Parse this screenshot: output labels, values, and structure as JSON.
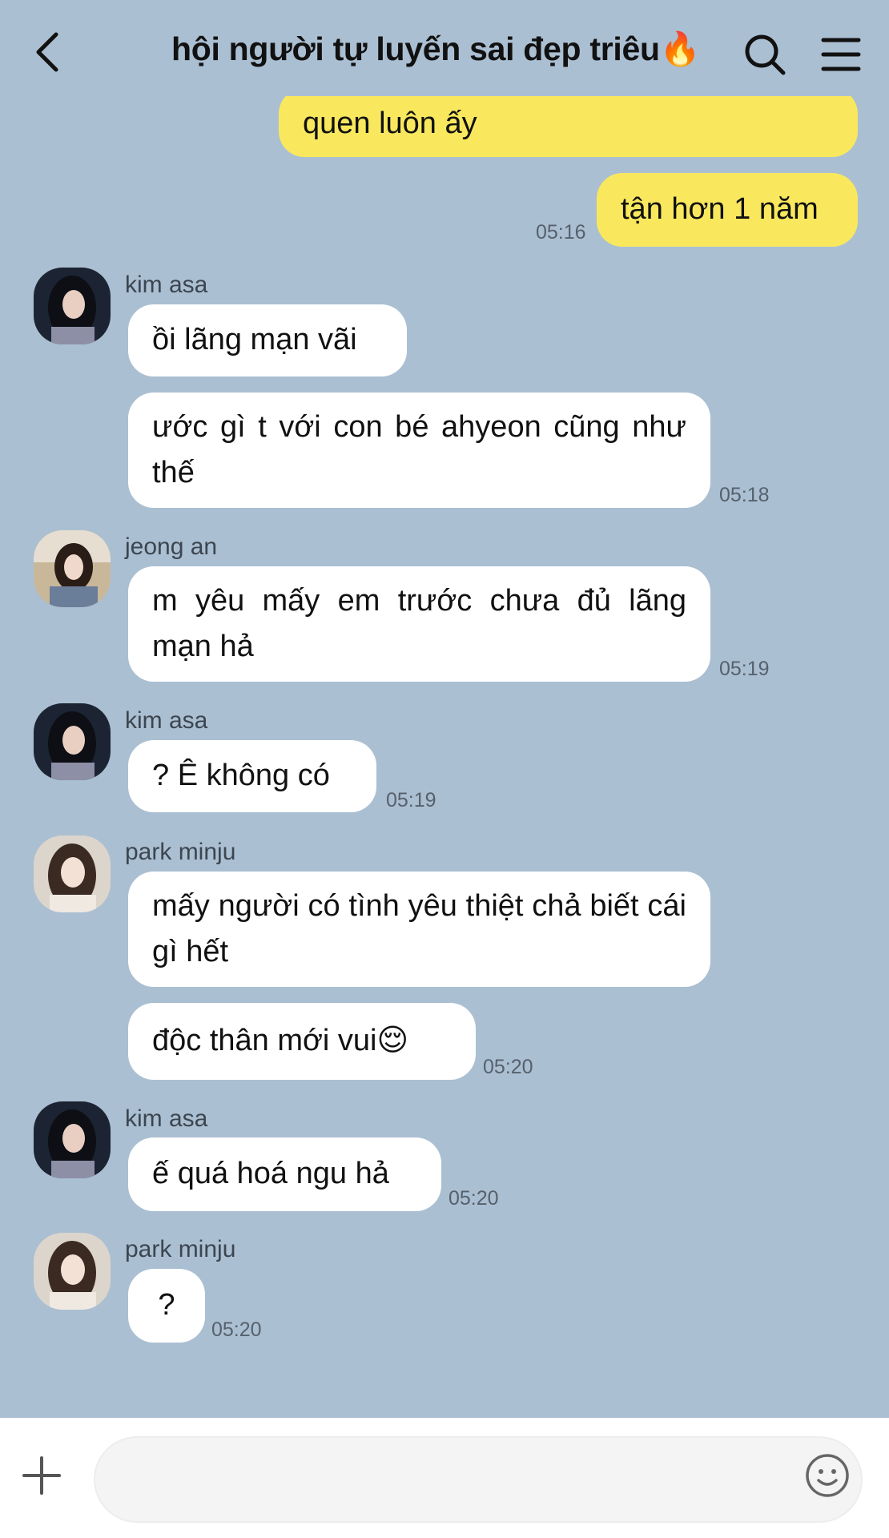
{
  "header": {
    "title": "hội người tự luyến sai đẹp triêu🔥"
  },
  "messages": {
    "m1": {
      "text": "quen luôn ấy"
    },
    "m2": {
      "text": "tận hơn 1 năm",
      "time": "05:16"
    },
    "g1": {
      "sender": "kim asa",
      "b1": "ồi lãng mạn vãi",
      "b2": "ước gì t với con bé ahyeon cũng như thế",
      "time": "05:18"
    },
    "g2": {
      "sender": "jeong an",
      "b1": "m yêu mấy em trước chưa đủ lãng mạn hả",
      "time": "05:19"
    },
    "g3": {
      "sender": "kim asa",
      "b1": "? Ê không có",
      "time": "05:19"
    },
    "g4": {
      "sender": "park minju",
      "b1": "mấy người có tình yêu thiệt chả biết cái gì hết",
      "b2": "độc thân mới vui😌",
      "time": "05:20"
    },
    "g5": {
      "sender": "kim asa",
      "b1": "ế quá hoá ngu hả",
      "time": "05:20"
    },
    "g6": {
      "sender": "park minju",
      "b1": "?",
      "time": "05:20"
    }
  },
  "icons": {
    "back": "chevron-left-icon",
    "search": "search-icon",
    "menu": "hamburger-menu-icon",
    "plus": "plus-icon",
    "emoji": "smiley-icon"
  },
  "colors": {
    "background": "#abbfd2",
    "my_bubble": "#f9e85d",
    "their_bubble": "#ffffff",
    "input_bar": "#ffffff"
  }
}
